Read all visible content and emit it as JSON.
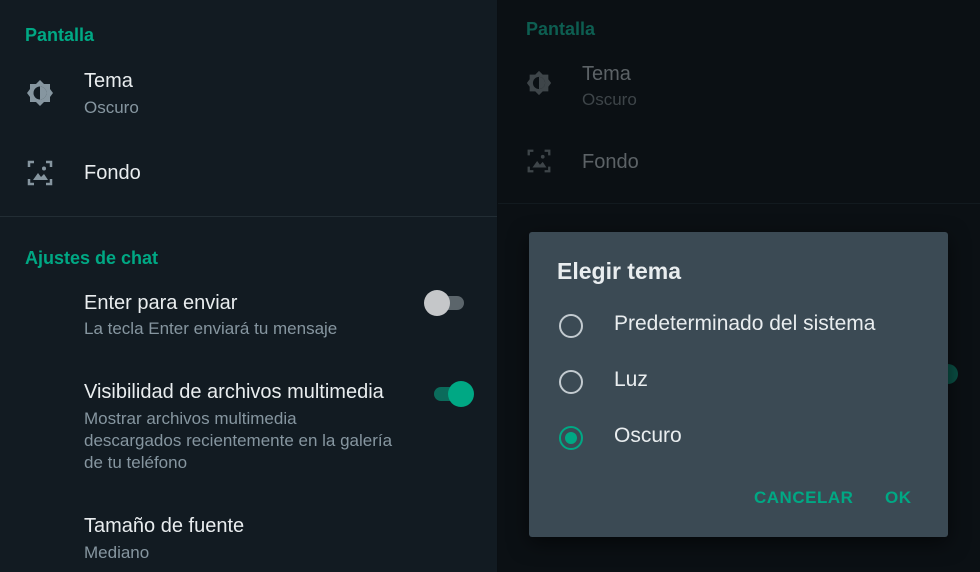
{
  "colors": {
    "accent": "#00a884",
    "background": "#121b22",
    "dialog": "#3b4a54",
    "text_primary": "#e9edef",
    "text_secondary": "#8696a0"
  },
  "settings": {
    "display_header": "Pantalla",
    "theme": {
      "title": "Tema",
      "value": "Oscuro",
      "icon": "brightness-icon"
    },
    "wallpaper": {
      "title": "Fondo",
      "icon": "wallpaper-icon"
    },
    "chat_header": "Ajustes de chat",
    "enter_to_send": {
      "title": "Enter para enviar",
      "subtitle": "La tecla Enter enviará tu mensaje",
      "enabled": false
    },
    "media_visibility": {
      "title": "Visibilidad de archivos multimedia",
      "subtitle_lines": [
        "Mostrar archivos multimedia",
        "descargados recientemente en la galería",
        "de tu teléfono"
      ],
      "enabled": true
    },
    "font_size": {
      "title": "Tamaño de fuente",
      "value": "Mediano"
    }
  },
  "dialog": {
    "title": "Elegir tema",
    "options": [
      {
        "label": "Predeterminado del sistema",
        "selected": false
      },
      {
        "label": "Luz",
        "selected": false
      },
      {
        "label": "Oscuro",
        "selected": true
      }
    ],
    "cancel_label": "CANCELAR",
    "ok_label": "OK"
  }
}
